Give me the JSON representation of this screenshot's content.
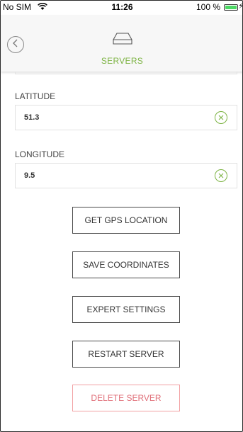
{
  "status_bar": {
    "carrier": "No SIM",
    "time": "11:26",
    "battery_text": "100 %",
    "battery_level": 1.0,
    "battery_color": "#4cd964"
  },
  "header": {
    "back_icon": "chevron-left-icon",
    "server_icon": "server-icon",
    "title": "SERVERS",
    "accent_color": "#7cb342"
  },
  "form": {
    "latitude": {
      "label": "LATITUDE",
      "value": "51.3",
      "clear_icon": "clear-circle-icon"
    },
    "longitude": {
      "label": "LONGITUDE",
      "value": "9.5",
      "clear_icon": "clear-circle-icon"
    }
  },
  "buttons": {
    "gps": "GET GPS LOCATION",
    "save": "SAVE COORDINATES",
    "expert": "EXPERT SETTINGS",
    "restart": "RESTART SERVER",
    "delete": "DELETE SERVER",
    "danger_color": "#e0707a"
  }
}
